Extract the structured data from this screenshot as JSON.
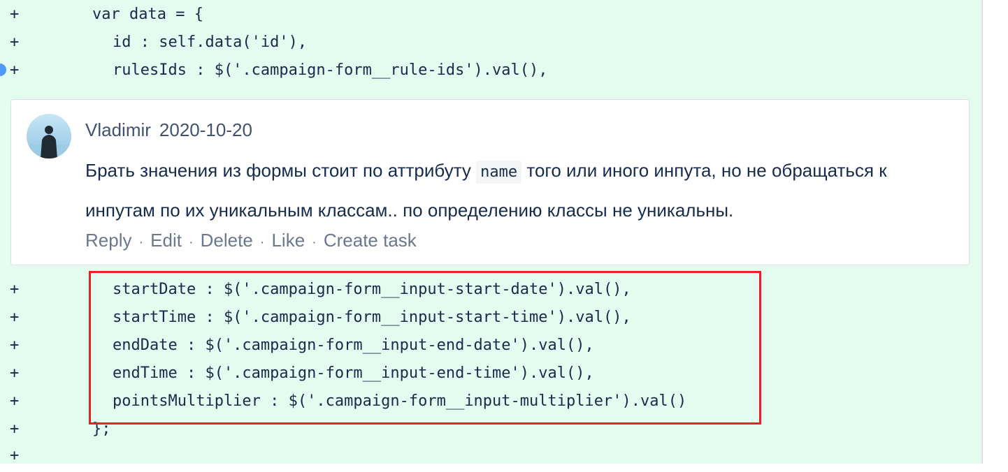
{
  "diff": {
    "lines_before": [
      {
        "sign": "+",
        "code": "var data = {"
      },
      {
        "sign": "+",
        "code": "id : self.data('id'),"
      },
      {
        "sign": "+",
        "code": "rulesIds : $('.campaign-form__rule-ids').val(),"
      }
    ],
    "lines_after": [
      {
        "sign": "+",
        "code": "startDate : $('.campaign-form__input-start-date').val(),"
      },
      {
        "sign": "+",
        "code": "startTime : $('.campaign-form__input-start-time').val(),"
      },
      {
        "sign": "+",
        "code": "endDate : $('.campaign-form__input-end-date').val(),"
      },
      {
        "sign": "+",
        "code": "endTime : $('.campaign-form__input-end-time').val(),"
      },
      {
        "sign": "+",
        "code": "pointsMultiplier : $('.campaign-form__input-multiplier').val()"
      },
      {
        "sign": "+",
        "code": "};"
      },
      {
        "sign": "+",
        "code": ""
      }
    ]
  },
  "comment": {
    "author": "Vladimir",
    "date": "2020-10-20",
    "text_before_code": "Брать значения из формы стоит по аттрибуту ",
    "inline_code": "name",
    "text_after_code": " того или иного инпута, но не обращаться к инпутам по их уникальным классам.. по определению классы не уникальны.",
    "actions": {
      "reply": "Reply",
      "edit": "Edit",
      "delete": "Delete",
      "like": "Like",
      "create_task": "Create task"
    },
    "separator": "·"
  },
  "colors": {
    "added_line_bg": "#e3fcef",
    "highlight_border": "#f41e1e",
    "marker": "#4c9aff"
  },
  "icons": {
    "avatar": "user-avatar",
    "marker": "comment-marker-dot"
  }
}
